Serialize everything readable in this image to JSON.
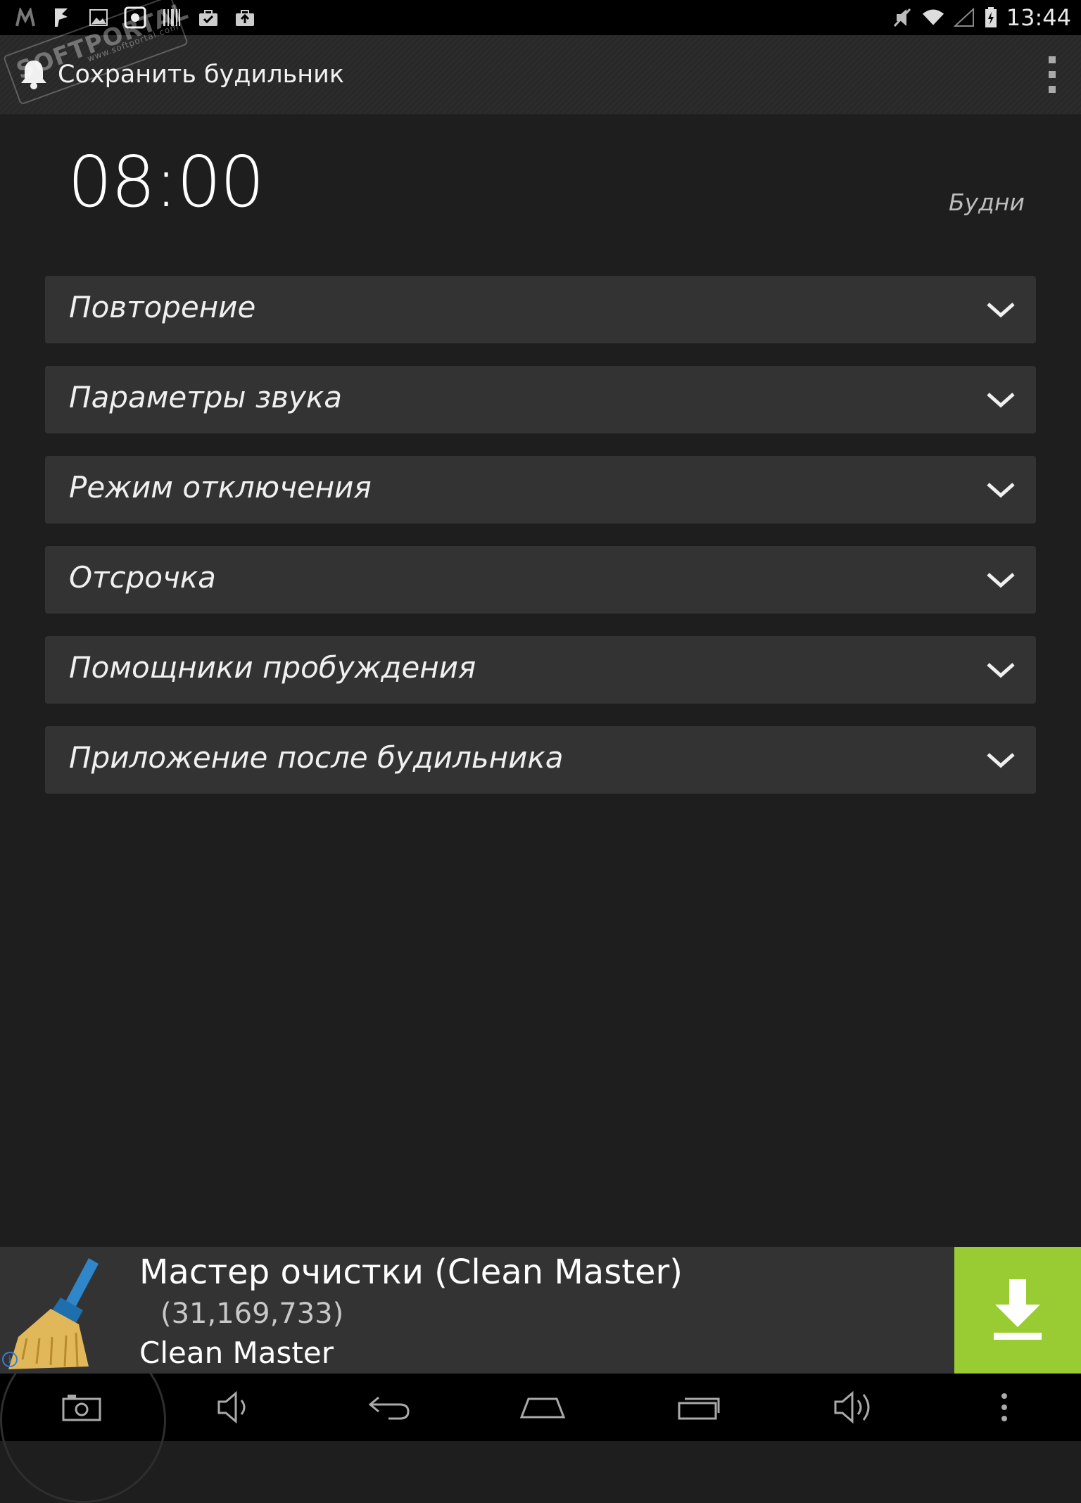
{
  "status_bar": {
    "time": "13:44",
    "left_icons": [
      "missed-call-icon",
      "flag-icon",
      "image-icon",
      "photo-app-icon",
      "barcode-icon",
      "bag-check-icon",
      "bag-upload-icon"
    ],
    "right_icons": [
      "mute-icon",
      "wifi-icon",
      "signal-icon",
      "battery-charging-icon"
    ]
  },
  "watermark": {
    "text": "SOFTPORTAL",
    "sub": "www.softportal.com"
  },
  "action_bar": {
    "title": "Сохранить будильник",
    "overflow_icon": "more-vertical-icon"
  },
  "alarm": {
    "time": "08:00",
    "days": "Будни"
  },
  "sections": [
    {
      "label": "Повторение"
    },
    {
      "label": "Параметры звука"
    },
    {
      "label": "Режим отключения"
    },
    {
      "label": "Отсрочка"
    },
    {
      "label": "Помощники пробуждения"
    },
    {
      "label": "Приложение после будильника"
    }
  ],
  "ad": {
    "title": "Мастер очистки (Clean Master)",
    "rating_count": "(31,169,733)",
    "developer": "Clean Master",
    "accent_color": "#99cc33"
  },
  "nav_bar": {
    "buttons": [
      "screenshot-icon",
      "volume-down-icon",
      "back-icon",
      "home-icon",
      "recents-icon",
      "volume-up-icon",
      "more-vertical-icon"
    ]
  }
}
